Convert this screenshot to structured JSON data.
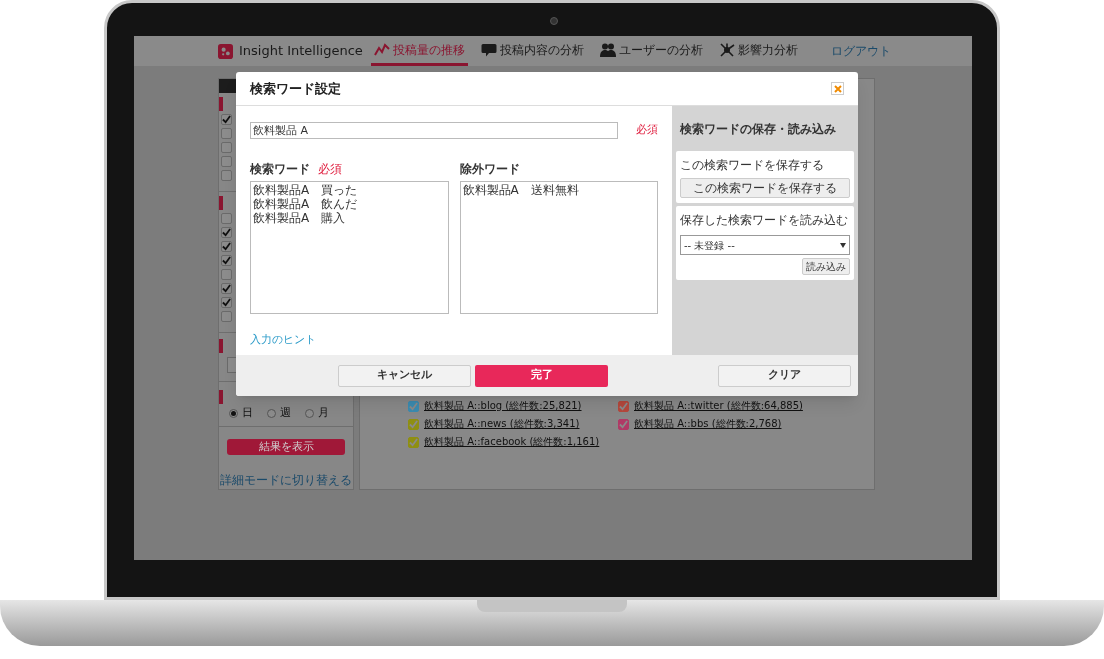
{
  "header": {
    "logo": "Insight Intelligence",
    "nav": [
      {
        "label": "投稿量の推移",
        "kind": "trend",
        "selected": true
      },
      {
        "label": "投稿内容の分析",
        "kind": "comment",
        "selected": false
      },
      {
        "label": "ユーザーの分析",
        "kind": "users",
        "selected": false
      },
      {
        "label": "影響力分析",
        "kind": "network",
        "selected": false
      }
    ],
    "logout": "ログアウト"
  },
  "sidebar": {
    "sections": [
      {
        "checkboxes": [
          {
            "checked": true
          },
          {
            "checked": false
          },
          {
            "checked": false
          },
          {
            "checked": false
          },
          {
            "checked": false
          }
        ]
      },
      {
        "checkboxes": [
          {
            "checked": false
          },
          {
            "checked": true
          },
          {
            "checked": true
          },
          {
            "checked": true
          },
          {
            "checked": false
          },
          {
            "checked": true
          },
          {
            "checked": true
          },
          {
            "checked": false
          }
        ]
      }
    ],
    "period": [
      {
        "label": "日",
        "selected": true
      },
      {
        "label": "週",
        "selected": false
      },
      {
        "label": "月",
        "selected": false
      }
    ],
    "show_button": "結果を表示",
    "mode_link": "詳細モードに切り替える"
  },
  "legend": [
    {
      "label": "飲料製品 A::blog (総件数:25,821)",
      "color": "#3b8bb0",
      "checked": true
    },
    {
      "label": "飲料製品 A::twitter (総件数:64,885)",
      "color": "#b4483c",
      "checked": true
    },
    {
      "label": "飲料製品 A::news (総件数:3,341)",
      "color": "#8f8f12",
      "checked": true
    },
    {
      "label": "飲料製品 A::bbs (総件数:2,768)",
      "color": "#b03a66",
      "checked": true
    },
    {
      "label": "飲料製品 A::facebook (総件数:1,161)",
      "color": "#8f8f12",
      "checked": true
    }
  ],
  "dialog": {
    "title": "検索ワード設定",
    "name_value": "飲料製品 A",
    "name_required": "必須",
    "search_words": {
      "label": "検索ワード",
      "required": "必須",
      "lines": [
        "飲料製品A　買った",
        "飲料製品A　飲んだ",
        "飲料製品A　購入"
      ]
    },
    "exclude_words": {
      "label": "除外ワード",
      "lines": [
        "飲料製品A　送料無料"
      ]
    },
    "hint_link": "入力のヒント",
    "save_panel": {
      "title": "検索ワードの保存・読み込み",
      "save_label": "この検索ワードを保存する",
      "save_button": "この検索ワードを保存する",
      "load_label": "保存した検索ワードを読み込む",
      "select_value": "-- 未登録 --",
      "load_button": "読み込み"
    },
    "buttons": {
      "cancel": "キャンセル",
      "done": "完了",
      "clear": "クリア"
    }
  }
}
